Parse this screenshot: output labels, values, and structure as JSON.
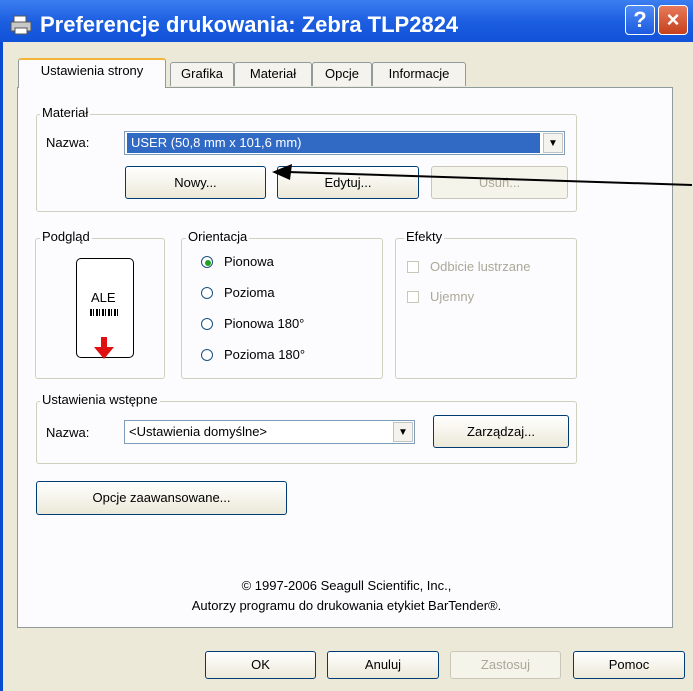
{
  "window": {
    "title": "Preferencje drukowania: Zebra TLP2824",
    "help_glyph": "?",
    "close_glyph": "×"
  },
  "tabs": [
    {
      "label": "Ustawienia strony",
      "active": true
    },
    {
      "label": "Grafika"
    },
    {
      "label": "Materiał"
    },
    {
      "label": "Opcje"
    },
    {
      "label": "Informacje"
    }
  ],
  "material": {
    "group_label": "Materiał",
    "name_label": "Nazwa:",
    "selected": "USER (50,8 mm x 101,6 mm)",
    "new_button": "Nowy...",
    "edit_button": "Edytuj...",
    "delete_button": "Usuń..."
  },
  "preview": {
    "group_label": "Podgląd",
    "sample_text": "ALE",
    "arrow_color": "#e01010"
  },
  "orientation": {
    "group_label": "Orientacja",
    "options": [
      "Pionowa",
      "Pozioma",
      "Pionowa 180°",
      "Pozioma 180°"
    ],
    "selected_index": 0
  },
  "effects": {
    "group_label": "Efekty",
    "mirror": "Odbicie lustrzane",
    "negative": "Ujemny"
  },
  "presets": {
    "group_label": "Ustawienia wstępne",
    "name_label": "Nazwa:",
    "selected": "<Ustawienia domyślne>",
    "manage_button": "Zarządzaj..."
  },
  "advanced_button": "Opcje zaawansowane...",
  "copyright": {
    "line1": "© 1997-2006 Seagull Scientific, Inc.,",
    "line2": "Autorzy programu do drukowania etykiet BarTender®."
  },
  "footer": {
    "ok": "OK",
    "cancel": "Anuluj",
    "apply": "Zastosuj",
    "help": "Pomoc"
  },
  "colors": {
    "titlebar": "#0a4bd4",
    "selection": "#316ac5",
    "dialog_bg": "#ece9d8"
  }
}
